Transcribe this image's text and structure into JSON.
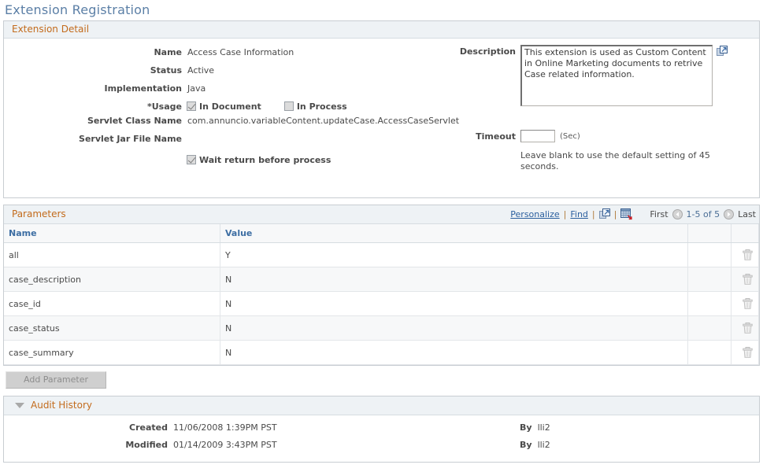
{
  "page_title": "Extension Registration",
  "colors": {
    "title": "#5b7fa6",
    "section_header": "#c36b1c",
    "link": "#2b5f9e",
    "column_header": "#3d6ea3",
    "header_bg": "#eef2f5"
  },
  "extension_detail": {
    "section_title": "Extension Detail",
    "fields": {
      "name_label": "Name",
      "name_value": "Access Case Information",
      "status_label": "Status",
      "status_value": "Active",
      "implementation_label": "Implementation",
      "implementation_value": "Java",
      "usage_label": "*Usage",
      "usage_in_document_label": "In Document",
      "usage_in_document_checked": true,
      "usage_in_process_label": "In Process",
      "usage_in_process_checked": false,
      "servlet_class_label": "Servlet Class Name",
      "servlet_class_value": "com.annuncio.variableContent.updateCase.AccessCaseServlet",
      "servlet_jar_label": "Servlet Jar File Name",
      "servlet_jar_value": "",
      "wait_return_label": "Wait return before process",
      "wait_return_checked": true
    },
    "description": {
      "label": "Description",
      "value": "This extension is used as Custom Content in Online Marketing documents to retrive Case related information.",
      "expand_icon": "expand-popout-icon"
    },
    "timeout": {
      "label": "Timeout",
      "value": "",
      "placeholder": "",
      "unit": "(Sec)",
      "hint": "Leave blank to use the default setting of 45 seconds."
    }
  },
  "parameters": {
    "section_title": "Parameters",
    "toolbar": {
      "personalize": "Personalize",
      "find": "Find",
      "separator": "|",
      "expand_icon": "expand-popout-icon",
      "download_icon": "download-spreadsheet-icon"
    },
    "pager": {
      "first": "First",
      "prev_icon": "prev-arrow-icon",
      "range": "1-5 of 5",
      "next_icon": "next-arrow-icon",
      "last": "Last"
    },
    "columns": [
      "Name",
      "Value"
    ],
    "rows": [
      {
        "name": "all",
        "value": "Y",
        "delete_icon": "trash-icon"
      },
      {
        "name": "case_description",
        "value": "N",
        "delete_icon": "trash-icon"
      },
      {
        "name": "case_id",
        "value": "N",
        "delete_icon": "trash-icon"
      },
      {
        "name": "case_status",
        "value": "N",
        "delete_icon": "trash-icon"
      },
      {
        "name": "case_summary",
        "value": "N",
        "delete_icon": "trash-icon"
      }
    ],
    "add_button": "Add Parameter"
  },
  "audit_history": {
    "section_title": "Audit History",
    "collapse_icon": "triangle-down-icon",
    "rows": [
      {
        "label": "Created",
        "value": "11/06/2008  1:39PM PST",
        "by_label": "By",
        "by_value": "lli2"
      },
      {
        "label": "Modified",
        "value": "01/14/2009  3:43PM PST",
        "by_label": "By",
        "by_value": "lli2"
      }
    ]
  }
}
